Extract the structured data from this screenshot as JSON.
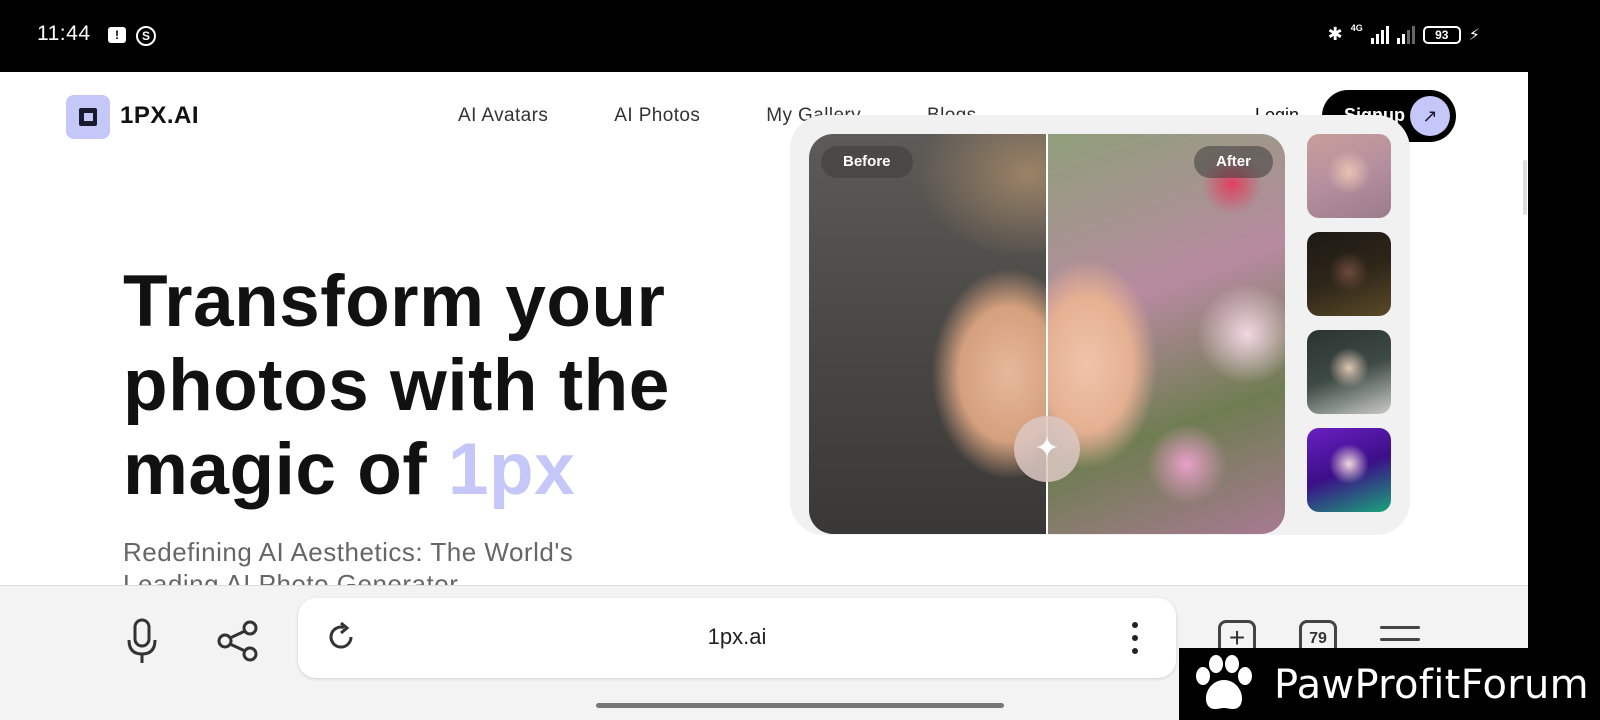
{
  "status_bar": {
    "time": "11:44",
    "network_label": "4G",
    "battery": "93"
  },
  "site": {
    "logo_text": "1PX.AI",
    "nav": [
      "AI Avatars",
      "AI Photos",
      "My Gallery",
      "Blogs"
    ],
    "login_label": "Login",
    "signup_label": "Signup",
    "signup_arrow": "↗"
  },
  "hero": {
    "line1": "Transform your",
    "line2": "photos with the",
    "line3_prefix": "magic of ",
    "line3_accent": "1px",
    "subtitle": "Redefining AI Aesthetics: The World's Leading AI Photo Generator"
  },
  "showcase": {
    "before_label": "Before",
    "after_label": "After",
    "magic_icon": "✦"
  },
  "browser": {
    "url": "1px.ai",
    "tab_count": "79"
  },
  "watermark": {
    "text": "PawProfitForum"
  },
  "colors": {
    "accent": "#c4c7f7",
    "signup_bg": "#000000"
  }
}
